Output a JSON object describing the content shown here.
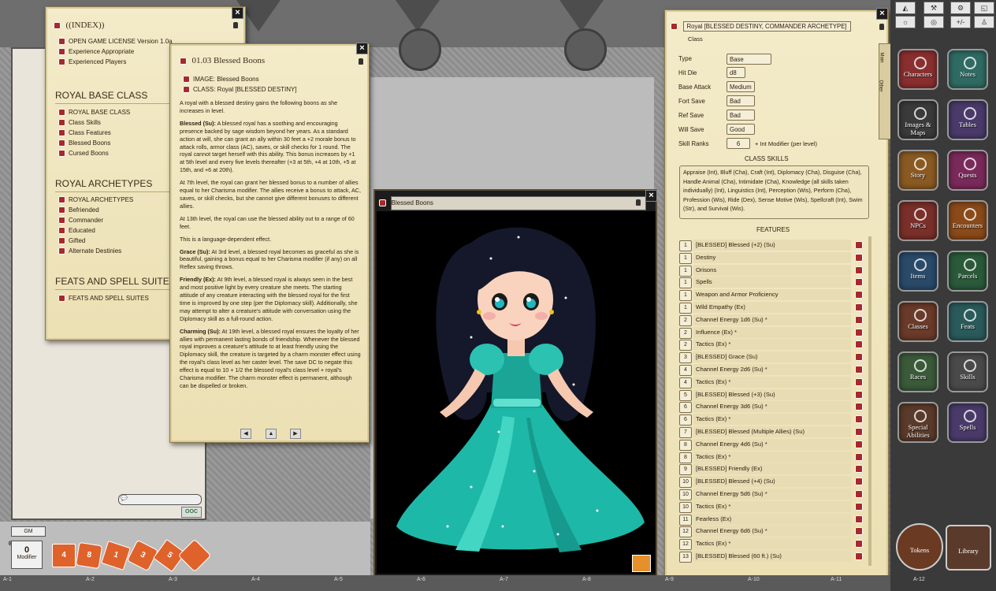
{
  "index_window": {
    "title": "((INDEX))",
    "top_items": [
      "OPEN GAME LICENSE Version 1.0a",
      "Experience Appropriate",
      "Experienced Players"
    ],
    "sections": [
      {
        "title": "ROYAL BASE CLASS",
        "items": [
          "ROYAL BASE CLASS",
          "Class Skills",
          "Class Features",
          "Blessed Boons",
          "Cursed Boons"
        ]
      },
      {
        "title": "ROYAL ARCHETYPES",
        "items": [
          "ROYAL ARCHETYPES",
          "Befriended",
          "Commander",
          "Educated",
          "Gifted",
          "Alternate Destinies"
        ]
      },
      {
        "title": "FEATS AND SPELL SUITES",
        "items": [
          "FEATS AND SPELL SUITES"
        ]
      }
    ]
  },
  "boons_window": {
    "title": "01.03 Blessed Boons",
    "links": [
      "IMAGE: Blessed Boons",
      "CLASS: Royal [BLESSED DESTINY]"
    ],
    "paragraphs": [
      {
        "lead": "",
        "text": "A royal with a blessed destiny gains the following boons as she increases in level."
      },
      {
        "lead": "Blessed (Su):",
        "text": " A blessed royal has a soothing and encouraging presence backed by sage wisdom beyond her years. As a standard action at will, she can grant an ally within 30 feet a +2 morale bonus to attack rolls, armor class (AC), saves, or skill checks for 1 round. The royal cannot target herself with this ability. This bonus increases by +1 at 5th level and every five levels thereafter (+3 at 5th, +4 at 10th, +5 at 15th, and +6 at 20th)."
      },
      {
        "lead": "",
        "text": "At 7th level, the royal can grant her blessed bonus to a number of allies equal to her Charisma modifier. The allies receive a bonus to attack, AC, saves, or skill checks, but she cannot give different bonuses to different allies."
      },
      {
        "lead": "",
        "text": "At 13th level, the royal can use the blessed ability out to a range of 60 feet."
      },
      {
        "lead": "",
        "text": "This is a language-dependent effect."
      },
      {
        "lead": "Grace (Su):",
        "text": " At 3rd level, a blessed royal becomes as graceful as she is beautiful, gaining a bonus equal to her Charisma modifier (if any) on all Reflex saving throws."
      },
      {
        "lead": "Friendly (Ex):",
        "text": " At 9th level, a blessed royal is always seen in the best and most positive light by every creature she meets. The starting attitude of any creature interacting with the blessed royal for the first time is improved by one step (per the Diplomacy skill). Additionally, she may attempt to alter a creature's attitude with conversation using the Diplomacy skill as a full-round action."
      },
      {
        "lead": "Charming (Su):",
        "text": " At 19th level, a blessed royal ensures the loyalty of her allies with permanent lasting bonds of friendship. Whenever the blessed royal improves a creature's attitude to at least friendly using the Diplomacy skill, the creature is targeted by a charm monster effect using the royal's class level as her caster level. The save DC to negate this effect is equal to 10 + 1/2 the blessed royal's class level + royal's Charisma modifier. The charm monster effect is permanent, although can be dispelled or broken."
      }
    ]
  },
  "image_window": {
    "title": "Blessed Boons"
  },
  "class_window": {
    "name": "Royal [BLESSED DESTINY, COMMANDER ARCHETYPE]",
    "subtitle": "Class",
    "side_tabs": [
      "Main",
      "Other"
    ],
    "type_label": "Type",
    "type_value": "Base",
    "hitdie_label": "Hit Die",
    "hitdie_value": "d8",
    "attack_label": "Base Attack",
    "attack_value": "Medium",
    "fort_label": "Fort Save",
    "fort_value": "Bad",
    "ref_label": "Ref Save",
    "ref_value": "Bad",
    "will_label": "Will Save",
    "will_value": "Good",
    "ranks_label": "Skill Ranks",
    "ranks_value": "6",
    "ranks_suffix": "+ Int Modifier (per level)",
    "skills_heading": "CLASS SKILLS",
    "skills_text": "Appraise (Int), Bluff (Cha), Craft (Int), Diplomacy (Cha), Disguise (Cha), Handle Animal (Cha), Intimidate (Cha), Knowledge (all skills taken individually) (Int), Linguistics (Int), Perception (Wis), Perform (Cha), Profession (Wis), Ride (Dex), Sense Motive (Wis), Spellcraft (Int), Swim (Str), and Survival (Wis).",
    "features_heading": "FEATURES",
    "features": [
      {
        "lv": "1",
        "name": "[BLESSED] Blessed (+2) (Su)"
      },
      {
        "lv": "1",
        "name": "Destiny"
      },
      {
        "lv": "1",
        "name": "Orisons"
      },
      {
        "lv": "1",
        "name": "Spells"
      },
      {
        "lv": "1",
        "name": "Weapon and Armor Proficiency"
      },
      {
        "lv": "1",
        "name": "Wild Empathy (Ex)"
      },
      {
        "lv": "2",
        "name": "Channel Energy 1d6 (Su) *"
      },
      {
        "lv": "2",
        "name": "Influence (Ex) *"
      },
      {
        "lv": "2",
        "name": "Tactics (Ex) *"
      },
      {
        "lv": "3",
        "name": "[BLESSED] Grace (Su)"
      },
      {
        "lv": "4",
        "name": "Channel Energy 2d6 (Su) *"
      },
      {
        "lv": "4",
        "name": "Tactics (Ex) *"
      },
      {
        "lv": "5",
        "name": "[BLESSED] Blessed (+3) (Su)"
      },
      {
        "lv": "6",
        "name": "Channel Energy 3d6 (Su) *"
      },
      {
        "lv": "6",
        "name": "Tactics (Ex) *"
      },
      {
        "lv": "7",
        "name": "[BLESSED] Blessed (Multiple Allies) (Su)"
      },
      {
        "lv": "8",
        "name": "Channel Energy 4d6 (Su) *"
      },
      {
        "lv": "8",
        "name": "Tactics (Ex) *"
      },
      {
        "lv": "9",
        "name": "[BLESSED] Friendly (Ex)"
      },
      {
        "lv": "10",
        "name": "[BLESSED] Blessed (+4) (Su)"
      },
      {
        "lv": "10",
        "name": "Channel Energy 5d6 (Su) *"
      },
      {
        "lv": "10",
        "name": "Tactics (Ex) *"
      },
      {
        "lv": "11",
        "name": "Fearless (Ex)"
      },
      {
        "lv": "12",
        "name": "Channel Energy 6d6 (Su) *"
      },
      {
        "lv": "12",
        "name": "Tactics (Ex) *"
      },
      {
        "lv": "13",
        "name": "[BLESSED] Blessed (60 ft.) (Su)"
      }
    ]
  },
  "sidebar": {
    "buttons": [
      {
        "label": "Characters",
        "color": "#8a2f2f"
      },
      {
        "label": "Notes",
        "color": "#2f6b63"
      },
      {
        "label": "Images & Maps",
        "color": "#3a3a3a"
      },
      {
        "label": "Tables",
        "color": "#4a3a6a"
      },
      {
        "label": "Story",
        "color": "#8a5a22"
      },
      {
        "label": "Quests",
        "color": "#7a2a5a"
      },
      {
        "label": "NPCs",
        "color": "#7a2f2a"
      },
      {
        "label": "Encounters",
        "color": "#8a4a1a"
      },
      {
        "label": "Items",
        "color": "#2a4a6a"
      },
      {
        "label": "Parcels",
        "color": "#2a5a3a"
      },
      {
        "label": "Classes",
        "color": "#6a3a2a"
      },
      {
        "label": "Feats",
        "color": "#2a5a5a"
      },
      {
        "label": "Races",
        "color": "#3a5a3a"
      },
      {
        "label": "Skills",
        "color": "#4a4a4a"
      },
      {
        "label": "Special Abilities",
        "color": "#5a3a2a"
      },
      {
        "label": "Spells",
        "color": "#4a3a6a"
      }
    ],
    "tokens_label": "Tokens",
    "library_label": "Library",
    "tools": [
      "◭",
      "⚒",
      "⚙",
      "◱",
      "☼",
      "◎",
      "+/-",
      "♙"
    ]
  },
  "bottom": {
    "gm_label": "GM",
    "modifier_value": "0",
    "modifier_label": "Modifier",
    "dice": [
      "4",
      "8",
      "1",
      "3",
      "5",
      ""
    ],
    "grid_labels": [
      "A-1",
      "A-2",
      "A-3",
      "A-4",
      "A-5",
      "A-6",
      "A-7",
      "A-8",
      "A-9",
      "A-10",
      "A-11",
      "A-12"
    ]
  },
  "chat": {
    "ooc": "OOC"
  },
  "colors": {
    "parchment": "#efe4bc",
    "accent_red": "#a62a2a",
    "dress_teal": "#1fb3a5"
  }
}
